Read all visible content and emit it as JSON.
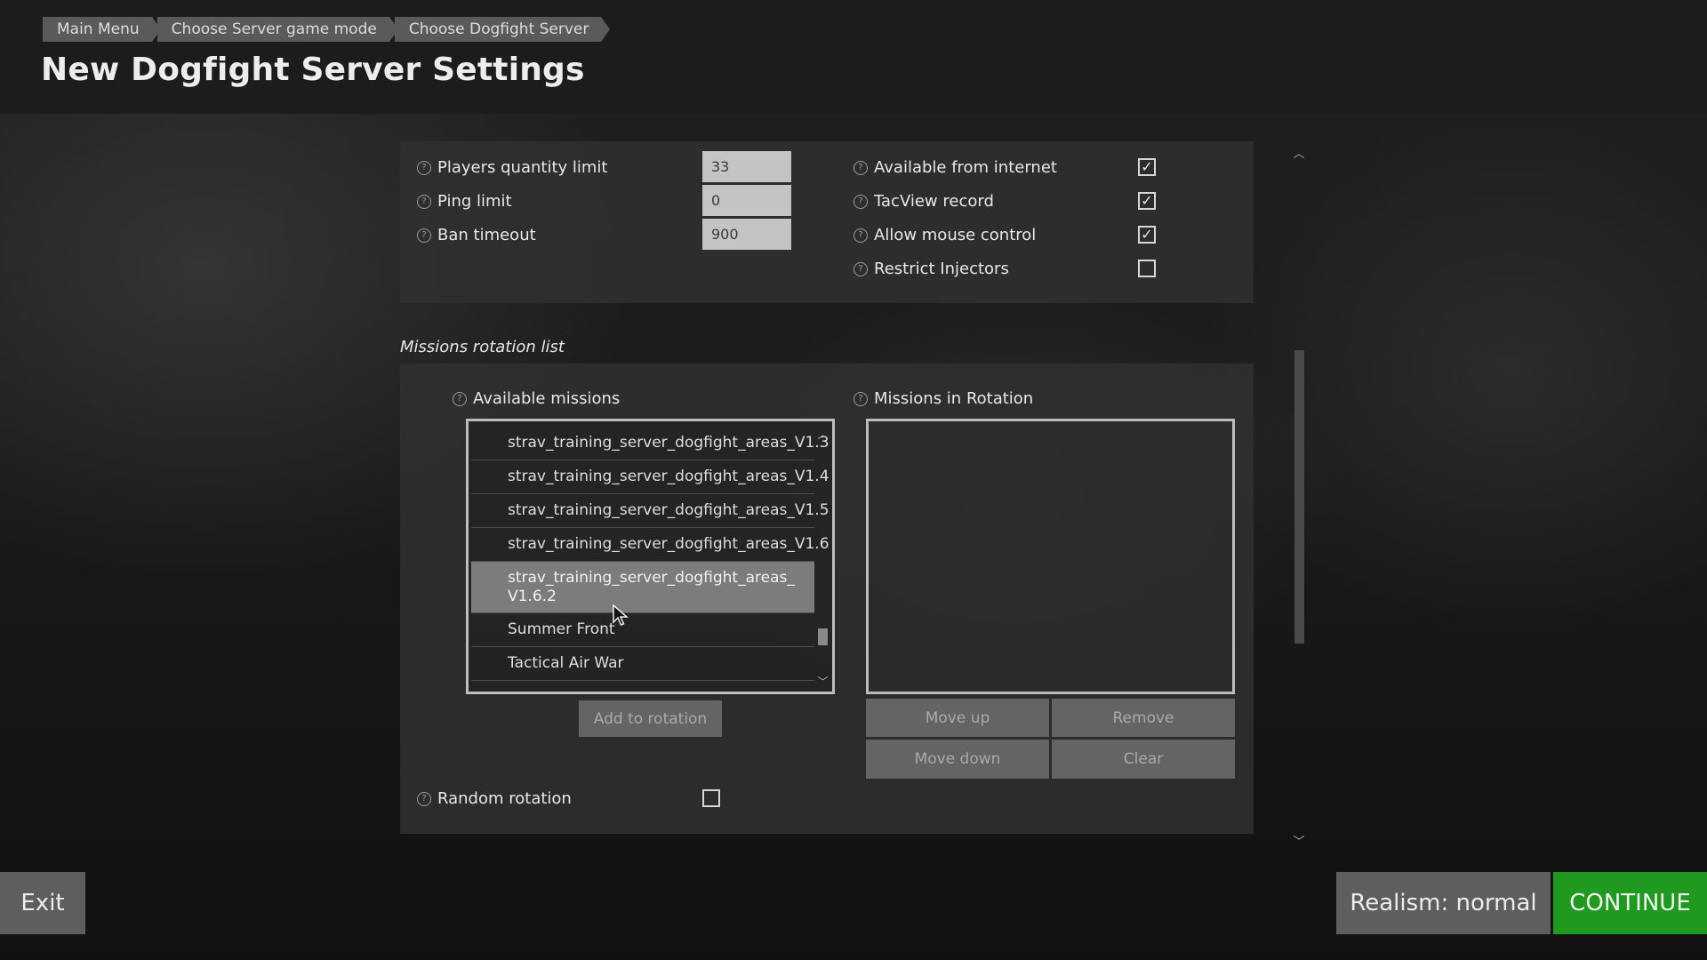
{
  "breadcrumb": [
    "Main Menu",
    "Choose Server game mode",
    "Choose Dogfight Server"
  ],
  "page_title": "New Dogfight Server Settings",
  "settings": {
    "players_limit": {
      "label": "Players quantity limit",
      "value": "33"
    },
    "ping_limit": {
      "label": "Ping limit",
      "value": "0"
    },
    "ban_timeout": {
      "label": "Ban timeout",
      "value": "900"
    },
    "available_from_internet": {
      "label": "Available from internet",
      "checked": true
    },
    "tacview_record": {
      "label": "TacView record",
      "checked": true
    },
    "allow_mouse_control": {
      "label": "Allow mouse control",
      "checked": true
    },
    "restrict_injectors": {
      "label": "Restrict Injectors",
      "checked": false
    }
  },
  "missions": {
    "section_title": "Missions rotation list",
    "available_label": "Available missions",
    "rotation_label": "Missions in Rotation",
    "available_items": [
      "strav_training_server_dogfight_areas_V1.3",
      "strav_training_server_dogfight_areas_V1.4",
      "strav_training_server_dogfight_areas_V1.5",
      "strav_training_server_dogfight_areas_V1.6",
      "strav_training_server_dogfight_areas_V1.6.2",
      "Summer Front",
      "Tactical Air War"
    ],
    "selected_item": "strav_training_server_dogfight_areas_V1.6.2",
    "rotation_items": [],
    "add_button": "Add to rotation",
    "move_up_button": "Move up",
    "remove_button": "Remove",
    "move_down_button": "Move down",
    "clear_button": "Clear",
    "random_rotation": {
      "label": "Random rotation",
      "checked": false
    }
  },
  "footer": {
    "exit": "Exit",
    "realism": "Realism: normal",
    "continue": "CONTINUE"
  },
  "colors": {
    "continue_green": "#1f9a1f",
    "panel_bg": "#303030",
    "selected_row": "#7c7c7c"
  },
  "icons": [
    "help-icon",
    "checkmark-icon",
    "chevron-up-icon",
    "chevron-down-icon",
    "mouse-cursor-icon"
  ]
}
